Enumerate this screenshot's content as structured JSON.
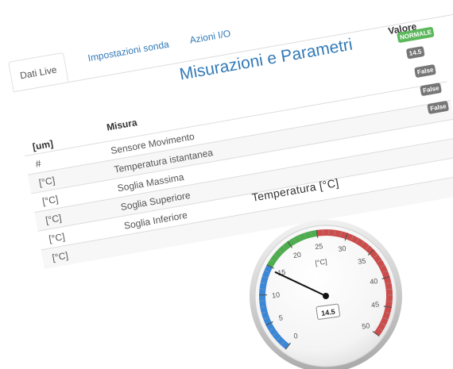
{
  "tabs": [
    {
      "label": "Dati Live",
      "active": true
    },
    {
      "label": "Impostazioni sonda",
      "active": false
    },
    {
      "label": "Azioni I/O",
      "active": false
    }
  ],
  "panel": {
    "title": "Misurazioni e Parametri",
    "col_unit": "[um]",
    "col_measure": "Misura",
    "col_value": "Valore"
  },
  "rows": [
    {
      "unit": "#",
      "name": "Sensore Movimento",
      "value": "NORMALE",
      "status": "ok"
    },
    {
      "unit": "[°C]",
      "name": "Temperatura istantanea",
      "value": "14.5"
    },
    {
      "unit": "[°C]",
      "name": "Soglia Massima",
      "value": "False"
    },
    {
      "unit": "[°C]",
      "name": "Soglia Superiore",
      "value": "False"
    },
    {
      "unit": "[°C]",
      "name": "Soglia Inferiore",
      "value": "False"
    },
    {
      "unit": "[°C]",
      "name": "",
      "value": ""
    }
  ],
  "gauge": {
    "title": "Temperatura [°C]",
    "unit": "[°C]",
    "value": 14.5,
    "value_label": "14.5",
    "min": 0,
    "max": 50,
    "tick_labels": [
      "0",
      "5",
      "10",
      "15",
      "20",
      "25",
      "30",
      "35",
      "40",
      "45",
      "50"
    ],
    "bands": [
      {
        "from": 0,
        "to": 15,
        "color": "#3a87d8"
      },
      {
        "from": 15,
        "to": 25,
        "color": "#4cae4c"
      },
      {
        "from": 25,
        "to": 50,
        "color": "#cc4b4b"
      }
    ],
    "needle_color": "#111111"
  },
  "colors": {
    "link": "#337ab7",
    "badge_ok": "#5cb85c",
    "badge_default": "#777777"
  }
}
